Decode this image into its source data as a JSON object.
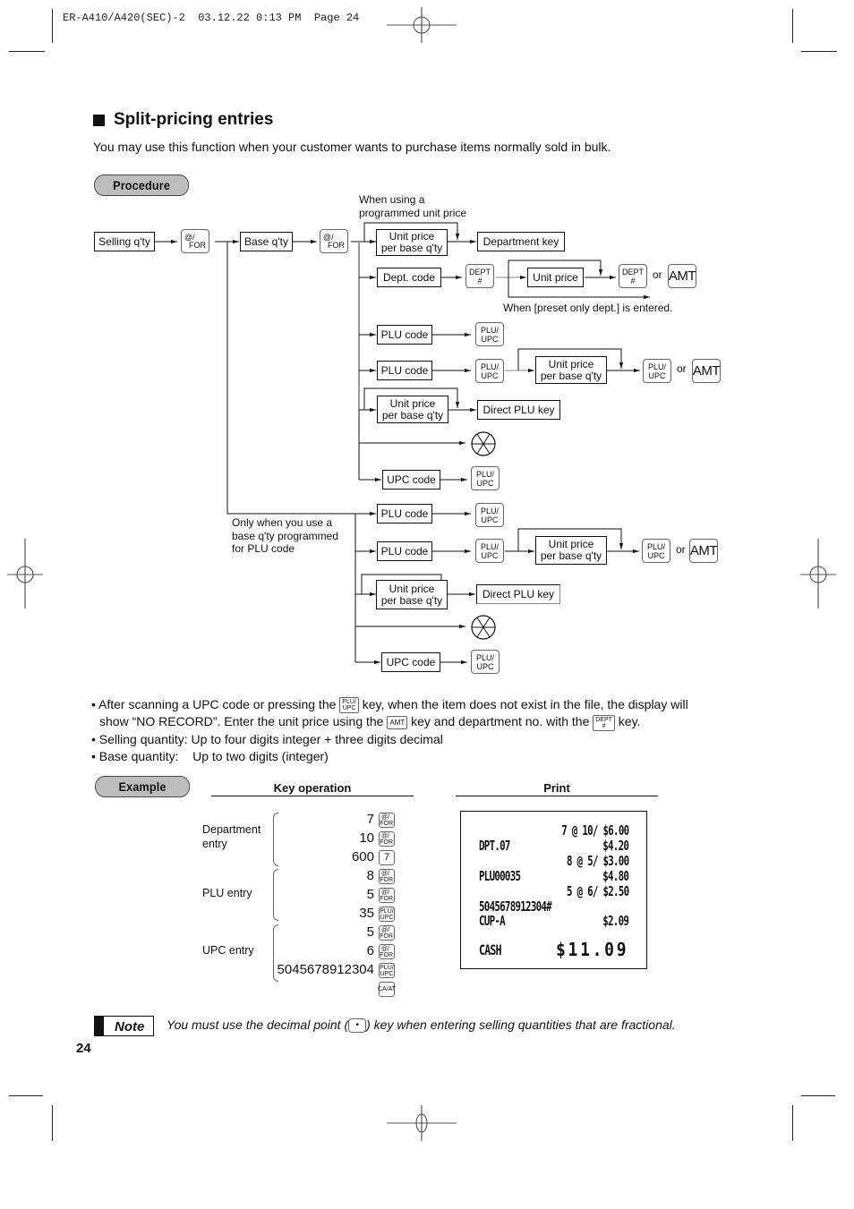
{
  "header": {
    "meta": "ER-A410/A420(SEC)-2  03.12.22 0:13 PM  Page 24"
  },
  "section": {
    "title": "Split-pricing entries",
    "intro": "You may use this function when your customer wants to purchase items normally sold in bulk."
  },
  "procedure": {
    "badge": "Procedure",
    "boxes": {
      "selling_qty": "Selling q'ty",
      "base_qty": "Base q'ty",
      "unit_price_per_base": "Unit price\nper base q'ty",
      "department_key": "Department key",
      "dept_code": "Dept. code",
      "unit_price": "Unit price",
      "plu_code": "PLU code",
      "direct_plu_key": "Direct PLU key",
      "upc_code": "UPC code"
    },
    "keys": {
      "at_for_top": "@/",
      "at_for_bottom": "FOR",
      "dept_top": "DEPT",
      "dept_bottom": "#",
      "plu_top": "PLU/",
      "plu_bottom": "UPC",
      "amt": "AMT",
      "multiply_icon": "circle-x-key"
    },
    "or": "or",
    "notes": {
      "programmed_unit_price": "When using a\nprogrammed unit price",
      "preset_only_dept": "When [preset only dept.] is entered.",
      "only_base_qty_plu": "Only when you use a\nbase q'ty programmed\nfor PLU code"
    }
  },
  "bullets": [
    {
      "parts": [
        "After scanning a UPC code or pressing the ",
        "{PLU}",
        " key, when the item does not exist in the file, the display will"
      ]
    },
    {
      "parts": [
        "show “NO RECORD”.  Enter the unit price using the ",
        "{AMT}",
        " key and department no. with the ",
        "{DEPT}",
        " key."
      ]
    },
    {
      "parts": [
        "Selling quantity: Up to four digits integer + three digits decimal"
      ]
    },
    {
      "parts": [
        "Base quantity:    Up to two digits (integer)"
      ]
    }
  ],
  "example": {
    "badge": "Example",
    "key_operation_header": "Key operation",
    "print_header": "Print",
    "groups": [
      {
        "label": "Department\nentry",
        "rows": [
          {
            "num": "7",
            "key": "@/FOR"
          },
          {
            "num": "10",
            "key": "@/FOR"
          },
          {
            "num": "600",
            "key": "7"
          }
        ]
      },
      {
        "label": "PLU entry",
        "rows": [
          {
            "num": "8",
            "key": "@/FOR"
          },
          {
            "num": "5",
            "key": "@/FOR"
          },
          {
            "num": "35",
            "key": "PLU/UPC"
          }
        ]
      },
      {
        "label": "UPC entry",
        "rows": [
          {
            "num": "5",
            "key": "@/FOR"
          },
          {
            "num": "6",
            "key": "@/FOR"
          },
          {
            "num": "5045678912304",
            "key": "PLU/UPC"
          },
          {
            "num": "",
            "key": "CA/AT"
          }
        ]
      }
    ],
    "receipt": [
      {
        "left": "",
        "right": "7 @ 10/ $6.00"
      },
      {
        "left": "DPT.07",
        "right": "$4.20"
      },
      {
        "left": "",
        "right": "8 @ 5/ $3.00"
      },
      {
        "left": "PLU00035",
        "right": "$4.80"
      },
      {
        "left": "",
        "right": "5 @ 6/ $2.50"
      },
      {
        "left": "5045678912304#",
        "right": ""
      },
      {
        "left": "CUP-A",
        "right": "$2.09"
      },
      {
        "left": "CASH",
        "right": "$11.09"
      }
    ]
  },
  "note": {
    "badge": "Note",
    "text_before": "You must use the decimal point (",
    "key": "•",
    "text_after": ") key when entering selling quantities that are fractional."
  },
  "page_number": "24"
}
